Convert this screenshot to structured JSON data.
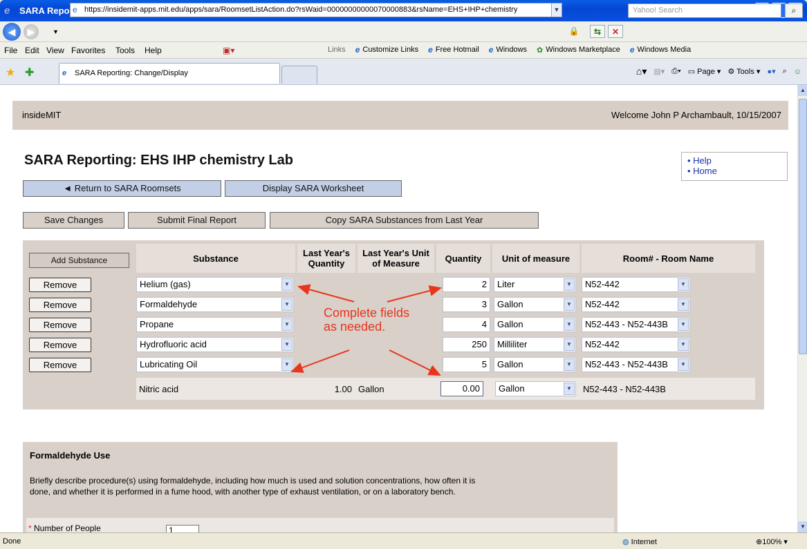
{
  "window": {
    "title": "SARA Reporting: Change/Display - Windows Internet Explorer"
  },
  "address": {
    "url": "https://insidemit-apps.mit.edu/apps/sara/RoomsetListAction.do?rsWaid=00000000000070000883&rsName=EHS+IHP+chemistry",
    "search_placeholder": "Yahoo! Search"
  },
  "menu": [
    "File",
    "Edit",
    "View",
    "Favorites",
    "Tools",
    "Help"
  ],
  "links": {
    "label": "Links",
    "items": [
      "Customize Links",
      "Free Hotmail",
      "Windows",
      "Windows Marketplace",
      "Windows Media"
    ]
  },
  "tab": {
    "label": "SARA Reporting: Change/Display"
  },
  "commandbar": {
    "page": "Page",
    "tools": "Tools"
  },
  "header": {
    "site": "insideMIT",
    "welcome": "Welcome John P Archambault, 10/15/2007"
  },
  "page": {
    "title": "SARA Reporting: EHS IHP chemistry Lab"
  },
  "help_links": [
    "Help",
    "Home"
  ],
  "buttons": {
    "return": "◄ Return to SARA Roomsets",
    "display": "Display SARA Worksheet",
    "save": "Save Changes",
    "submit": "Submit Final Report",
    "copy": "Copy SARA Substances from Last Year",
    "add": "Add Substance",
    "remove": "Remove"
  },
  "table": {
    "headers": {
      "substance": "Substance",
      "last_qty": "Last Year's Quantity",
      "last_unit": "Last Year's Unit of Measure",
      "qty": "Quantity",
      "unit": "Unit of measure",
      "room": "Room# - Room Name"
    },
    "rows": [
      {
        "substance": "Helium (gas)",
        "qty": "2",
        "unit": "Liter",
        "room": "N52-442"
      },
      {
        "substance": "Formaldehyde",
        "qty": "3",
        "unit": "Gallon",
        "room": "N52-442"
      },
      {
        "substance": "Propane",
        "qty": "4",
        "unit": "Gallon",
        "room": "N52-443 - N52-443B"
      },
      {
        "substance": "Hydrofluoric acid",
        "qty": "250",
        "unit": "Milliliter",
        "room": "N52-442"
      },
      {
        "substance": "Lubricating Oil",
        "qty": "5",
        "unit": "Gallon",
        "room": "N52-443 - N52-443B"
      }
    ],
    "last_row": {
      "substance": "Nitric acid",
      "last_qty": "1.00",
      "last_unit": "Gallon",
      "qty": "0.00",
      "unit": "Gallon",
      "room": "N52-443 - N52-443B"
    }
  },
  "annotation": {
    "line1": "Complete fields",
    "line2": "as needed."
  },
  "formaldehyde": {
    "title": "Formaldehyde Use",
    "description": "Briefly describe procedure(s) using formaldehyde, including how much is used and solution concentrations, how often it is done, and whether it is performed in a fume hood, with another type of exhaust ventilation, or on a laboratory bench.",
    "people_label": "Number of People",
    "people_value": "1"
  },
  "status": {
    "left": "Done",
    "zone": "Internet",
    "zoom": "100%"
  },
  "colors": {
    "annotation": "#e8351c",
    "panel": "#d8d0c9",
    "blue_button": "#c3cfe6"
  }
}
